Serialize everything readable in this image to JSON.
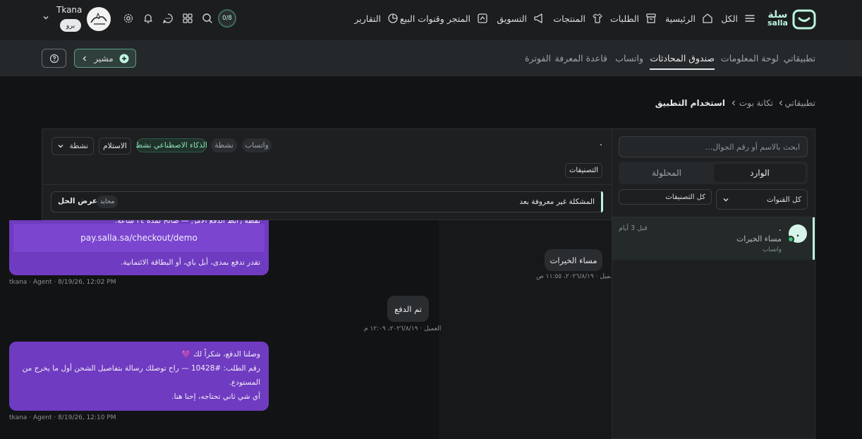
{
  "brand": {
    "name_ar": "سلة",
    "name_en": "salla"
  },
  "topnav": {
    "all": "الكل",
    "home": "الرئيسية",
    "orders": "الطلبات",
    "products": "المنتجات",
    "marketing": "التسويق",
    "store": "المتجر وقنوات البيع",
    "reports": "التقارير",
    "progress_badge": "0/8",
    "store_name": "Tkana",
    "plan_badge": "برو"
  },
  "subnav": {
    "tabs": [
      "تطبيقاتي",
      "لوحة المعلومات",
      "صندوق المحادثات",
      "واتساب",
      "قاعدة المعرفة",
      "الفوترة"
    ],
    "active_tab": "صندوق المحادثات",
    "mushir_label": "مشير"
  },
  "breadcrumb": {
    "items": [
      "تطبيقاتي",
      "تكانة بوت",
      "استخدام التطبيق"
    ]
  },
  "sidebar": {
    "search_placeholder": "ابحث بالاسم أو رقم الجوال...",
    "tab_inbox": "الوارد",
    "tab_resolved": "المحلولة",
    "filter_channels": "كل القنوات",
    "filter_categories": "كل التصنيفات",
    "conversation": {
      "name": ".",
      "avatar_initial": ".",
      "preview": "مساء الخيرات",
      "channel": "واتساب",
      "time": "قبل 3 أيام"
    }
  },
  "chat_header": {
    "contact_name": ".",
    "chip_whatsapp": "واتساب",
    "chip_active": "نشطة",
    "chip_ai": "الذكاء الاصطناعي نشط",
    "button_receive": "الاستلام",
    "status_select": "نشطة",
    "categories_button": "التصنيفات",
    "issue_text": "المشكلة غير معروفة بعد",
    "issue_badge": "محايد",
    "view_solution": "عرض الحل"
  },
  "messages": {
    "agent1_partial": "نقطة رابط الدفع الآمن — صالح لمدة ٢٤ ساعة.",
    "agent1_link": "pay.salla.sa/checkout/demo",
    "agent1_tail": "تقدر تدفع بمدى، أبل باي، أو البطاقة الائتمانية.",
    "agent1_meta": "tkana · Agent · 8/19/26, 12:02 PM",
    "customer1_text": "مساء الخيرات",
    "customer1_meta": "العميل · ٢٠٢٦/٨/١٩، ١١:٥٥ ص",
    "customer2_text": "تم الدفع",
    "customer2_meta": "العميل · ٢٠٢٦/٨/١٩، ١٢:٠٩ م",
    "agent2_line1": "وصلنا الدفع، شكراً لك 💜",
    "agent2_line2": "رقم الطلب: #10428 — راح توصلك رسالة بتفاصيل الشحن أول ما يخرج من",
    "agent2_line3": "المستودع.",
    "agent2_line4": "أي شي ثاني تحتاجه، إحنا هنا.",
    "agent2_meta": "tkana · Agent · 8/19/26, 12:10 PM"
  },
  "colors": {
    "accent_green": "#bdf5e0",
    "agent_bubble": "#6f3bc0",
    "link_box": "#7b45d0"
  }
}
